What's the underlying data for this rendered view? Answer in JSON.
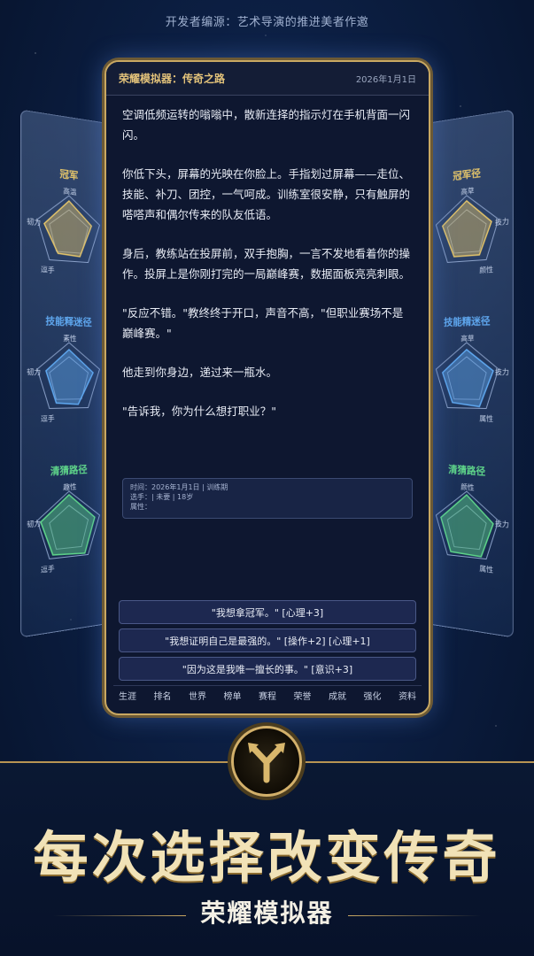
{
  "credit": "开发者编源：艺术导演的推进美者作邀",
  "app": {
    "title": "荣耀模拟器：传奇之路",
    "date": "2026年1月1日"
  },
  "story": [
    "空调低频运转的嗡嗡中，散新连择的指示灯在手机背面一闪闪。",
    "你低下头，屏幕的光映在你脸上。手指划过屏幕——走位、技能、补刀、团控，一气呵成。训练室很安静，只有触屏的嗒嗒声和偶尔传来的队友低语。",
    "身后，教练站在投屏前，双手抱胸，一言不发地看着你的操作。投屏上是你刚打完的一局巅峰赛，数据面板亮亮刺眼。",
    "\"反应不错。\"教终终于开口，声音不高，\"但职业赛场不是巅峰赛。\"",
    "他走到你身边，递过来一瓶水。",
    "\"告诉我，你为什么想打职业？\""
  ],
  "info": {
    "line1": "时间：2026年1月1日 | 训练期",
    "line2": "选手：| 未要 | 18岁",
    "line3": "属性："
  },
  "choices": [
    "\"我想拿冠军。\" [心理+3]",
    "\"我想证明自己是最强的。\" [操作+2] [心理+1]",
    "\"因为这是我唯一擅长的事。\" [意识+3]"
  ],
  "nav": [
    "生涯",
    "排名",
    "世界",
    "榜单",
    "赛程",
    "荣誉",
    "成就",
    "强化",
    "资料"
  ],
  "left_panels": [
    {
      "title": "冠军",
      "top": "高温",
      "left": "韧力",
      "bottom": "逗手",
      "color": "#e3c46a"
    },
    {
      "title": "技能释迷径",
      "top": "素性",
      "left": "韧力",
      "bottom": "逗手",
      "color": "#5fa8f0"
    },
    {
      "title": "清猜路径",
      "top": "趣性",
      "left": "韧力",
      "bottom": "逗手",
      "color": "#5fd68a"
    }
  ],
  "right_panels": [
    {
      "title": "冠军径",
      "top": "高草",
      "right": "技力",
      "bottom": "颜性",
      "color": "#e3c46a"
    },
    {
      "title": "技能精迷径",
      "top": "高草",
      "right": "技力",
      "bottom": "属性",
      "color": "#5fa8f0"
    },
    {
      "title": "清猜路径",
      "top": "颜性",
      "right": "技力",
      "bottom": "属性",
      "color": "#5fd68a"
    }
  ],
  "headline": "每次选择改变传奇",
  "subline": "荣耀模拟器"
}
